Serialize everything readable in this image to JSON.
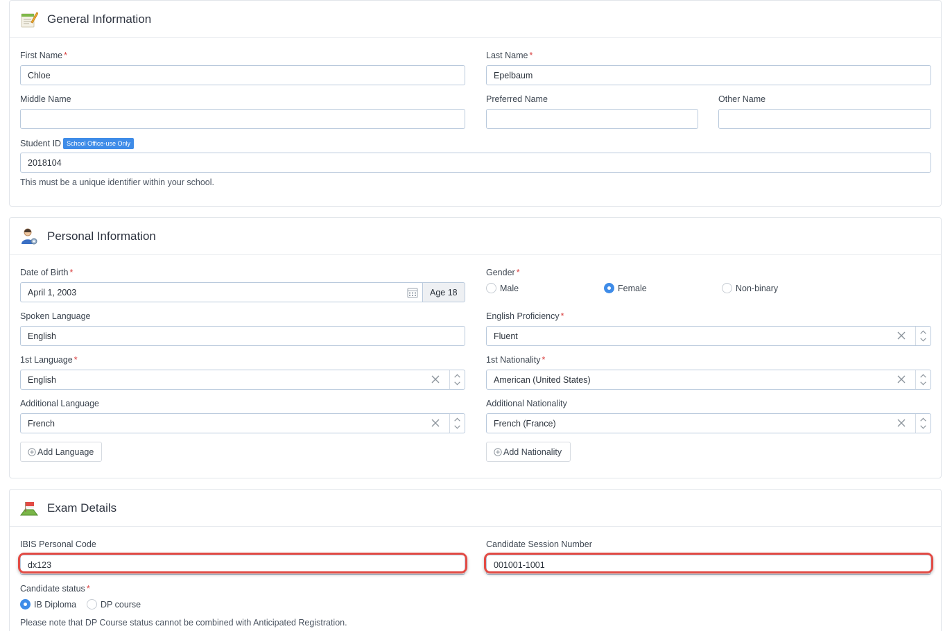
{
  "general": {
    "title": "General Information",
    "icon": "notepad-pencil-icon",
    "first_name": {
      "label": "First Name",
      "required": "*",
      "value": "Chloe"
    },
    "last_name": {
      "label": "Last Name",
      "required": "*",
      "value": "Epelbaum"
    },
    "middle_name": {
      "label": "Middle Name",
      "value": ""
    },
    "preferred_name": {
      "label": "Preferred Name",
      "value": ""
    },
    "other_name": {
      "label": "Other Name",
      "value": ""
    },
    "student_id": {
      "label": "Student ID",
      "badge": "School Office-use Only",
      "value": "2018104",
      "help": "This must be a unique identifier within your school."
    }
  },
  "personal": {
    "title": "Personal Information",
    "icon": "user-settings-icon",
    "dob": {
      "label": "Date of Birth",
      "required": "*",
      "value": "April 1, 2003",
      "age": "Age 18"
    },
    "gender": {
      "label": "Gender",
      "required": "*",
      "options": [
        "Male",
        "Female",
        "Non-binary"
      ],
      "selected": "Female"
    },
    "spoken_language": {
      "label": "Spoken Language",
      "value": "English"
    },
    "english_proficiency": {
      "label": "English Proficiency",
      "required": "*",
      "value": "Fluent"
    },
    "first_language": {
      "label": "1st Language",
      "required": "*",
      "value": "English"
    },
    "first_nationality": {
      "label": "1st Nationality",
      "required": "*",
      "value": "American (United States)"
    },
    "additional_language": {
      "label": "Additional Language",
      "value": "French"
    },
    "additional_nationality": {
      "label": "Additional Nationality",
      "value": "French (France)"
    },
    "add_language": "Add Language",
    "add_nationality": "Add Nationality"
  },
  "exam": {
    "title": "Exam Details",
    "icon": "exam-flag-icon",
    "ibis_code": {
      "label": "IBIS Personal Code",
      "value": "dx123"
    },
    "session_number": {
      "label": "Candidate Session Number",
      "value": "001001-1001"
    },
    "candidate_status": {
      "label": "Candidate status",
      "required": "*",
      "options": [
        "IB Diploma",
        "DP course"
      ],
      "selected": "IB Diploma",
      "note": "Please note that DP Course status cannot be combined with Anticipated Registration."
    }
  },
  "colors": {
    "accent": "#3f8ce8",
    "required": "#d94040",
    "highlight": "#e24b45",
    "input_border": "#b9c9dc"
  }
}
